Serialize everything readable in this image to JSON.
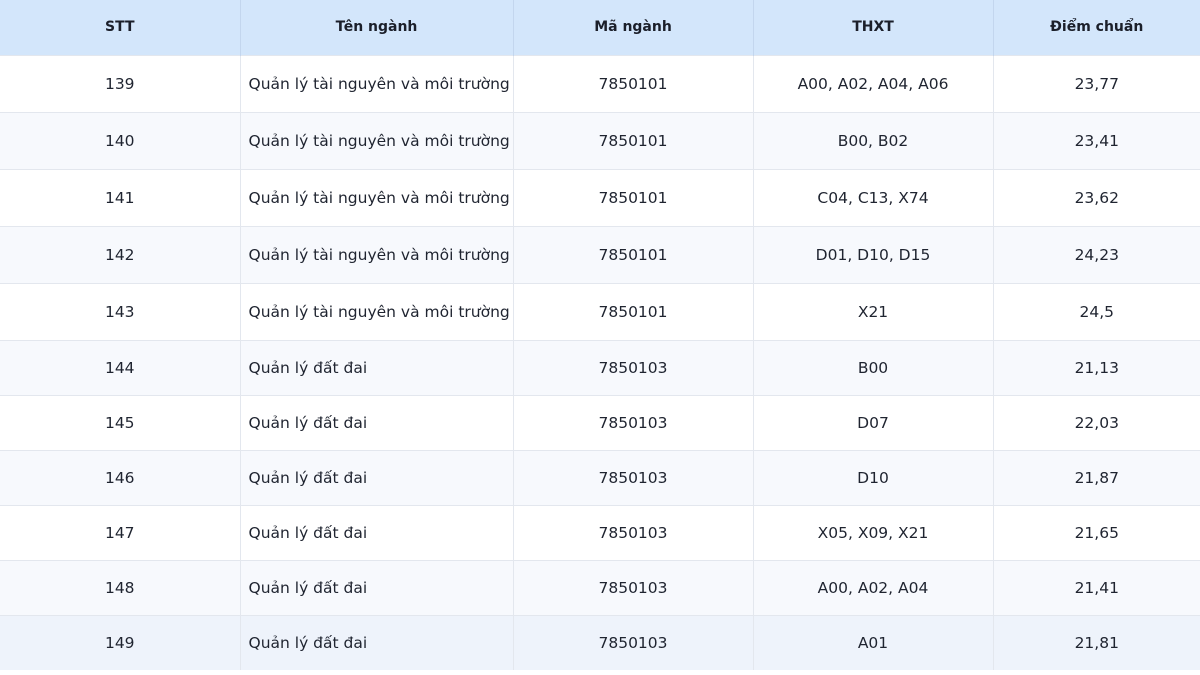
{
  "table": {
    "headers": [
      "STT",
      "Tên ngành",
      "Mã ngành",
      "THXT",
      "Điểm chuẩn"
    ],
    "rows": [
      [
        "139",
        "Quản lý tài nguyên và môi trường",
        "7850101",
        "A00, A02, A04, A06",
        "23,77"
      ],
      [
        "140",
        "Quản lý tài nguyên và môi trường",
        "7850101",
        "B00, B02",
        "23,41"
      ],
      [
        "141",
        "Quản lý tài nguyên và môi trường",
        "7850101",
        "C04, C13, X74",
        "23,62"
      ],
      [
        "142",
        "Quản lý tài nguyên và môi trường",
        "7850101",
        "D01, D10, D15",
        "24,23"
      ],
      [
        "143",
        "Quản lý tài nguyên và môi trường",
        "7850101",
        "X21",
        "24,5"
      ],
      [
        "144",
        "Quản lý đất đai",
        "7850103",
        "B00",
        "21,13"
      ],
      [
        "145",
        "Quản lý đất đai",
        "7850103",
        "D07",
        "22,03"
      ],
      [
        "146",
        "Quản lý đất đai",
        "7850103",
        "D10",
        "21,87"
      ],
      [
        "147",
        "Quản lý đất đai",
        "7850103",
        "X05, X09, X21",
        "21,65"
      ],
      [
        "148",
        "Quản lý đất đai",
        "7850103",
        "A00, A02, A04",
        "21,41"
      ],
      [
        "149",
        "Quản lý đất đai",
        "7850103",
        "A01",
        "21,81"
      ]
    ]
  },
  "colors": {
    "header_bg": "#d3e6fb",
    "row_alt_bg": "#f7f9fd",
    "border": "#e3e7ee"
  }
}
